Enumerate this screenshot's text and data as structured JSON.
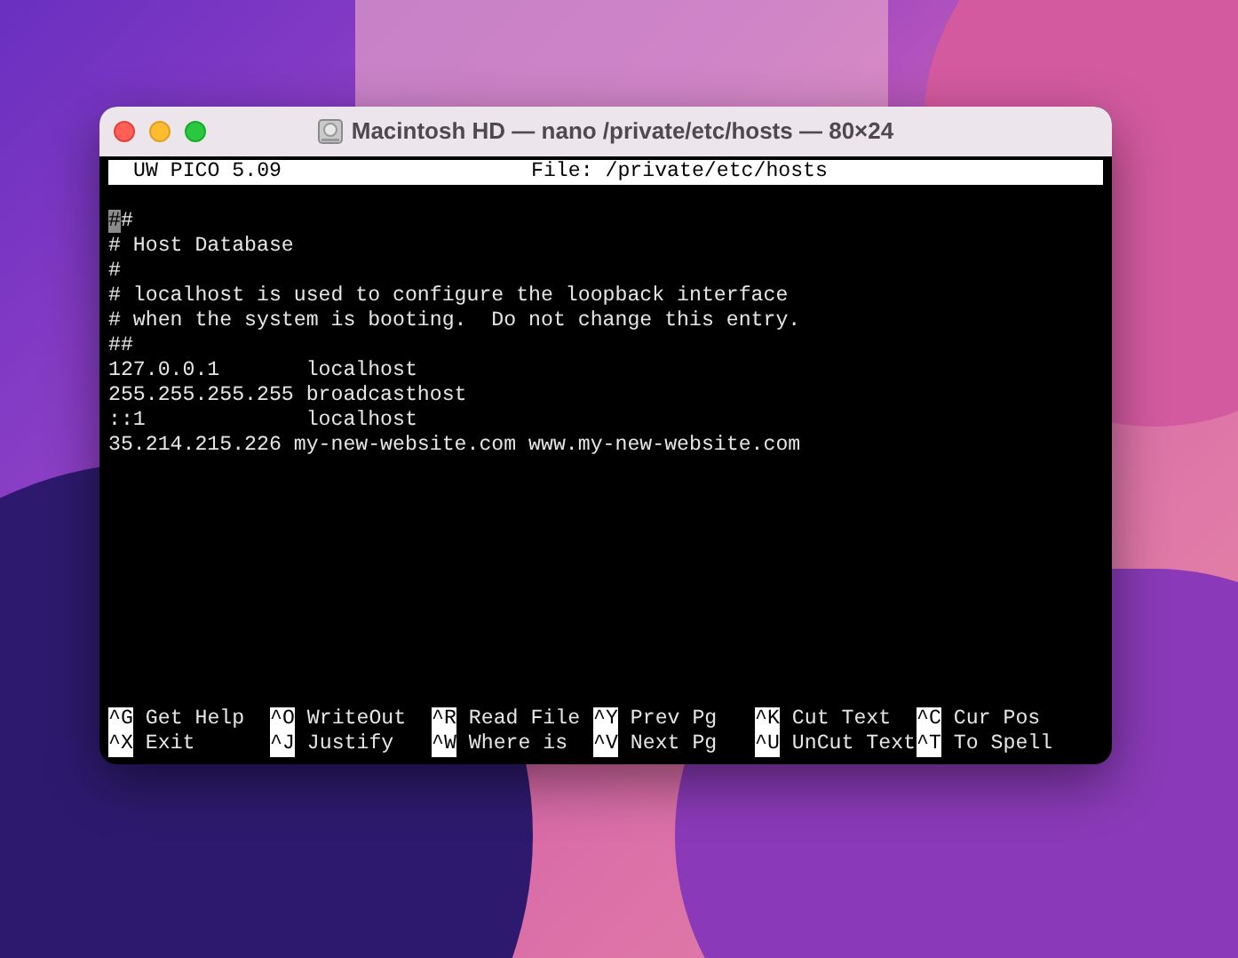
{
  "window": {
    "title": "Macintosh HD — nano /private/etc/hosts — 80×24"
  },
  "editor": {
    "program": "UW PICO 5.09",
    "file": "File: /private/etc/hosts",
    "lines": [
      {
        "text": "##",
        "cursor": true
      },
      {
        "text": "# Host Database",
        "cursor": false
      },
      {
        "text": "#",
        "cursor": false
      },
      {
        "text": "# localhost is used to configure the loopback interface",
        "cursor": false
      },
      {
        "text": "# when the system is booting.  Do not change this entry.",
        "cursor": false
      },
      {
        "text": "##",
        "cursor": false
      },
      {
        "text": "127.0.0.1       localhost",
        "cursor": false
      },
      {
        "text": "255.255.255.255 broadcasthost",
        "cursor": false
      },
      {
        "text": "::1             localhost",
        "cursor": false
      },
      {
        "text": "35.214.215.226 my-new-website.com www.my-new-website.com",
        "cursor": false
      }
    ],
    "shortcut_rows": [
      [
        {
          "key": "^G",
          "label": "Get Help"
        },
        {
          "key": "^O",
          "label": "WriteOut"
        },
        {
          "key": "^R",
          "label": "Read File"
        },
        {
          "key": "^Y",
          "label": "Prev Pg"
        },
        {
          "key": "^K",
          "label": "Cut Text"
        },
        {
          "key": "^C",
          "label": "Cur Pos"
        }
      ],
      [
        {
          "key": "^X",
          "label": "Exit"
        },
        {
          "key": "^J",
          "label": "Justify"
        },
        {
          "key": "^W",
          "label": "Where is"
        },
        {
          "key": "^V",
          "label": "Next Pg"
        },
        {
          "key": "^U",
          "label": "UnCut Text"
        },
        {
          "key": "^T",
          "label": "To Spell"
        }
      ]
    ]
  }
}
